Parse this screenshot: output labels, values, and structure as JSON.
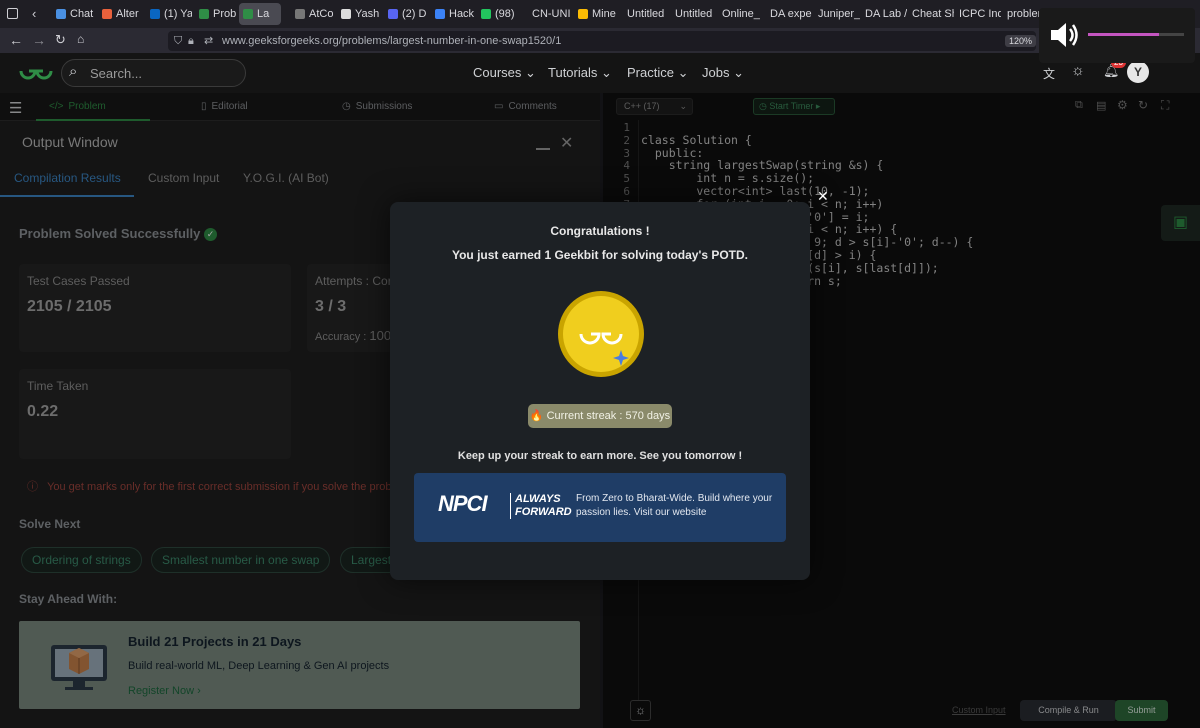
{
  "browser": {
    "tabs": [
      {
        "label": "Chat",
        "color": "#4a90e2"
      },
      {
        "label": "Alter",
        "color": "#e8613c"
      },
      {
        "label": "(1) Ya",
        "color": "#0a66c2"
      },
      {
        "label": "Prob",
        "color": "#2f8d46"
      },
      {
        "label": "La",
        "color": "#2f8d46"
      },
      {
        "label": "AtCo",
        "color": "#777777"
      },
      {
        "label": "Yash",
        "color": "#dddddd"
      },
      {
        "label": "(2) D",
        "color": "#5865f2"
      },
      {
        "label": "Hack",
        "color": "#3b82f6"
      },
      {
        "label": "(98) ",
        "color": "#22c55e"
      },
      {
        "label": "CN-UNI",
        "color": ""
      },
      {
        "label": "Mine",
        "color": "#fbbc04"
      },
      {
        "label": "Untitled",
        "color": ""
      },
      {
        "label": "Untitled",
        "color": ""
      },
      {
        "label": "Online_",
        "color": ""
      },
      {
        "label": "DA expe",
        "color": ""
      },
      {
        "label": "Juniper_",
        "color": ""
      },
      {
        "label": "DA Lab /",
        "color": ""
      },
      {
        "label": "Cheat Sh",
        "color": ""
      },
      {
        "label": "ICPC Ind",
        "color": ""
      },
      {
        "label": "problem",
        "color": ""
      }
    ],
    "url": "www.geeksforgeeks.org/problems/largest-number-in-one-swap1520/1",
    "zoom": "120%"
  },
  "header": {
    "search_placeholder": "Search...",
    "nav": [
      "Courses",
      "Tutorials",
      "Practice",
      "Jobs"
    ],
    "notification_count": "23",
    "avatar_letter": "Y"
  },
  "problem_tabs": [
    "Problem",
    "Editorial",
    "Submissions",
    "Comments"
  ],
  "output": {
    "title": "Output Window",
    "tabs": [
      "Compilation Results",
      "Custom Input",
      "Y.O.G.I. (AI Bot)"
    ],
    "status": "Problem Solved Successfully",
    "test_cases_label": "Test Cases Passed",
    "test_cases_value": "2105 / 2105",
    "attempts_label": "Attempts : Corr",
    "attempts_value": "3 / 3",
    "accuracy_label": "Accuracy :",
    "accuracy_value": "100",
    "time_label": "Time Taken",
    "time_value": "0.22",
    "warning": "You get marks only for the first correct submission if you solve the problem",
    "solve_next_label": "Solve Next",
    "solve_next": [
      "Ordering of strings",
      "Smallest number in one swap",
      "Largest"
    ],
    "stay_ahead_label": "Stay Ahead With:",
    "promo_title": "Build 21 Projects in 21 Days",
    "promo_sub": "Build real-world ML, Deep Learning & Gen AI projects",
    "promo_link": "Register Now"
  },
  "editor": {
    "language": "C++ (17)",
    "timer": "Start Timer",
    "lines": [
      "",
      "class Solution {",
      "  public:",
      "    string largestSwap(string &s) {",
      "        int n = s.size();",
      "        vector<int> last(10, -1);",
      "        for (int i = 0; i < n; i++)",
      "            last[s[i] - '0'] = i;",
      "        for (int i = 0; i < n; i++) {",
      "            for (int d = 9; d > s[i]-'0'; d--) {",
      "                if (last[d] > i) {",
      "                    swap(s[i], s[last[d]]);",
      "                    return s;"
    ],
    "custom_input": "Custom Input",
    "compile_run": "Compile & Run",
    "submit": "Submit"
  },
  "modal": {
    "title": "Congratulations !",
    "subtitle": "You just earned 1 Geekbit for solving today's POTD.",
    "streak": "🔥 Current streak : 570 days",
    "footer": "Keep up your streak to earn more. See you tomorrow !",
    "ad_brand": "NPCI",
    "ad_tag1": "ALWAYS",
    "ad_tag2": "FORWARD",
    "ad_text": "From Zero to Bharat-Wide. Build where your passion lies. Visit our website"
  }
}
